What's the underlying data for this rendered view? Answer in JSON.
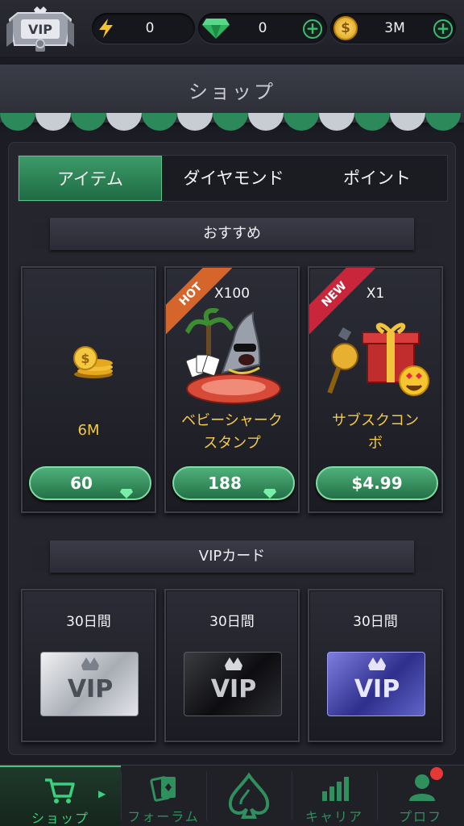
{
  "topbar": {
    "vip_badge_label": "VIP",
    "energy_value": "0",
    "diamond_value": "0",
    "coin_value": "3M",
    "coin_symbol": "$"
  },
  "header": {
    "title": "ショップ"
  },
  "tabs": [
    {
      "label": "アイテム",
      "active": true
    },
    {
      "label": "ダイヤモンド",
      "active": false
    },
    {
      "label": "ポイント",
      "active": false
    }
  ],
  "sections": {
    "recommended": "おすすめ",
    "vip_cards": "VIPカード"
  },
  "recommended_items": [
    {
      "qty": "",
      "name": "6M",
      "price": "60",
      "price_type": "diamond",
      "tag": ""
    },
    {
      "qty": "X100",
      "name_lines": [
        "ベビーシャーク",
        "スタンプ"
      ],
      "price": "188",
      "price_type": "diamond",
      "tag": "HOT"
    },
    {
      "qty": "X1",
      "name_lines": [
        "サブスクコン",
        "ボ"
      ],
      "price": "$4.99",
      "price_type": "cash",
      "tag": "NEW"
    }
  ],
  "vip_cards": [
    {
      "duration": "30日間",
      "card_label": "VIP",
      "tier": "silver"
    },
    {
      "duration": "30日間",
      "card_label": "VIP",
      "tier": "black"
    },
    {
      "duration": "30日間",
      "card_label": "VIP",
      "tier": "purple"
    }
  ],
  "bottom_nav": [
    {
      "label": "ショップ",
      "icon": "cart-icon",
      "active": true
    },
    {
      "label": "フォーラム",
      "icon": "cards-icon",
      "active": false
    },
    {
      "label": "",
      "icon": "spade-logo-icon",
      "active": false
    },
    {
      "label": "キャリア",
      "icon": "bar-chart-icon",
      "active": false
    },
    {
      "label": "プロフ",
      "icon": "profile-icon",
      "active": false,
      "notification": true
    }
  ],
  "colors": {
    "accent_green": "#3bbd74",
    "gold_text": "#f3c945",
    "hot_tag": "#d5652a",
    "new_tag": "#c9263b",
    "notification_dot": "#e53935"
  }
}
